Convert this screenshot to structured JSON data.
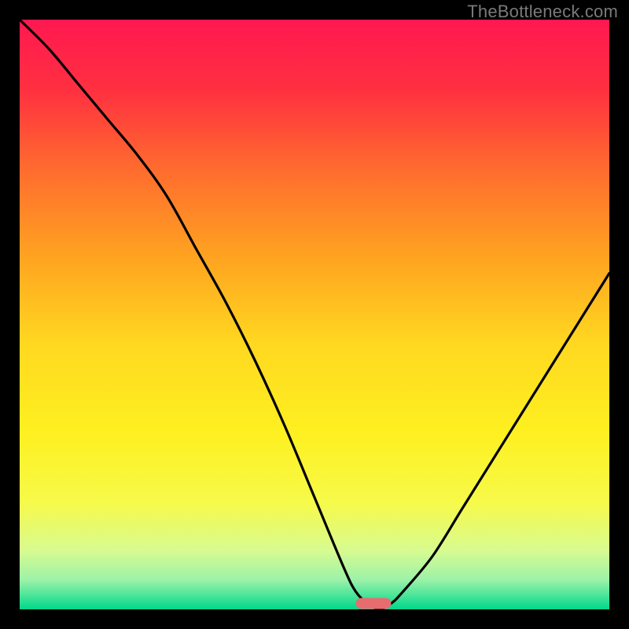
{
  "watermark": {
    "text": "TheBottleneck.com"
  },
  "chart_data": {
    "type": "line",
    "title": "",
    "xlabel": "",
    "ylabel": "",
    "xlim": [
      0,
      100
    ],
    "ylim": [
      0,
      100
    ],
    "legend": false,
    "grid": false,
    "x": [
      0,
      5,
      10,
      15,
      20,
      25,
      30,
      35,
      40,
      45,
      50,
      55,
      57,
      59,
      61,
      63,
      65,
      70,
      75,
      80,
      85,
      90,
      95,
      100
    ],
    "values": [
      100,
      95,
      89,
      83,
      77,
      70,
      61,
      52,
      42,
      31,
      19,
      7,
      3,
      1,
      0,
      1,
      3,
      9,
      17,
      25,
      33,
      41,
      49,
      57
    ],
    "annotations": [
      {
        "kind": "sweet-spot-marker",
        "x_range": [
          57,
          63
        ],
        "y": 1
      }
    ],
    "background_gradient": {
      "stops": [
        {
          "pos": 0.0,
          "color": "#ff1850"
        },
        {
          "pos": 0.12,
          "color": "#ff3040"
        },
        {
          "pos": 0.25,
          "color": "#ff6a2f"
        },
        {
          "pos": 0.4,
          "color": "#ffa220"
        },
        {
          "pos": 0.55,
          "color": "#ffd820"
        },
        {
          "pos": 0.7,
          "color": "#fef020"
        },
        {
          "pos": 0.82,
          "color": "#f6fa4a"
        },
        {
          "pos": 0.9,
          "color": "#d8fb90"
        },
        {
          "pos": 0.95,
          "color": "#9cf2a8"
        },
        {
          "pos": 0.975,
          "color": "#4ee59a"
        },
        {
          "pos": 1.0,
          "color": "#00d88c"
        }
      ]
    },
    "marker_color": "#e86c6f"
  }
}
